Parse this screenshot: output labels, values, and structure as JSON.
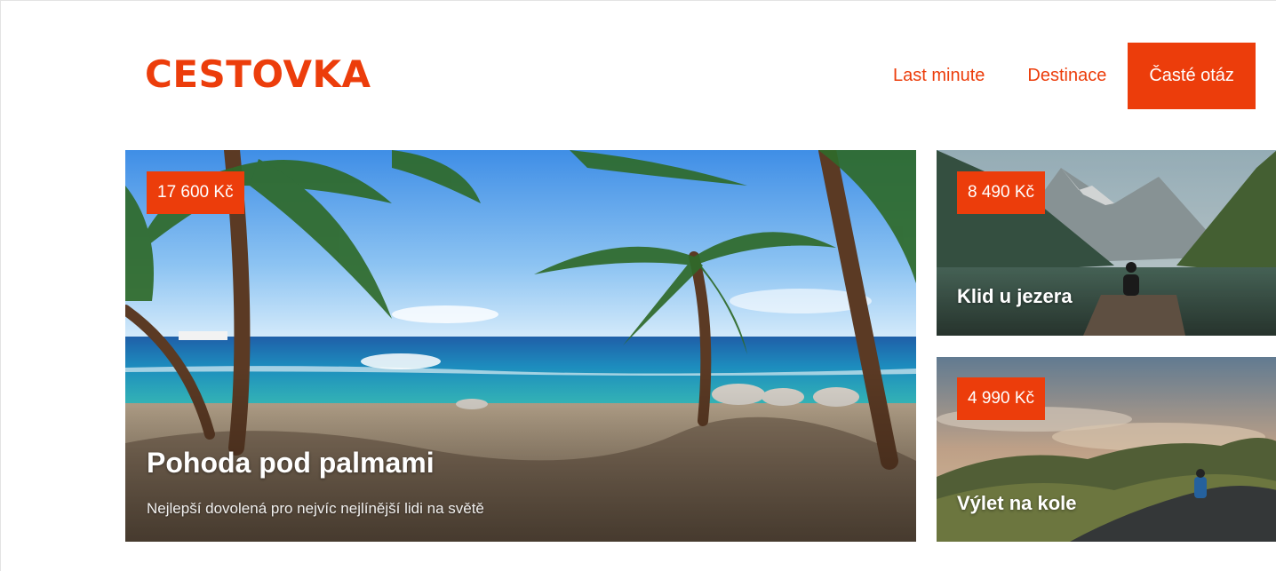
{
  "header": {
    "logo": "CESTOVKA",
    "nav": [
      {
        "label": "Last minute",
        "active": false
      },
      {
        "label": "Destinace",
        "active": false
      },
      {
        "label": "Časté otáz",
        "active": true
      }
    ]
  },
  "offers": {
    "main": {
      "price": "17 600 Kč",
      "title": "Pohoda pod palmami",
      "description": "Nejlepší dovolená pro nejvíc nejlínější lidi na světě",
      "image": "beach-with-palm-trees"
    },
    "lake": {
      "price": "8 490 Kč",
      "title": "Klid u jezera",
      "image": "mountain-lake-with-pier"
    },
    "bike": {
      "price": "4 990 Kč",
      "title": "Výlet na kole",
      "image": "cyclist-on-hill-road"
    }
  },
  "colors": {
    "brand": "#ec3d0b",
    "background": "#ffffff"
  }
}
